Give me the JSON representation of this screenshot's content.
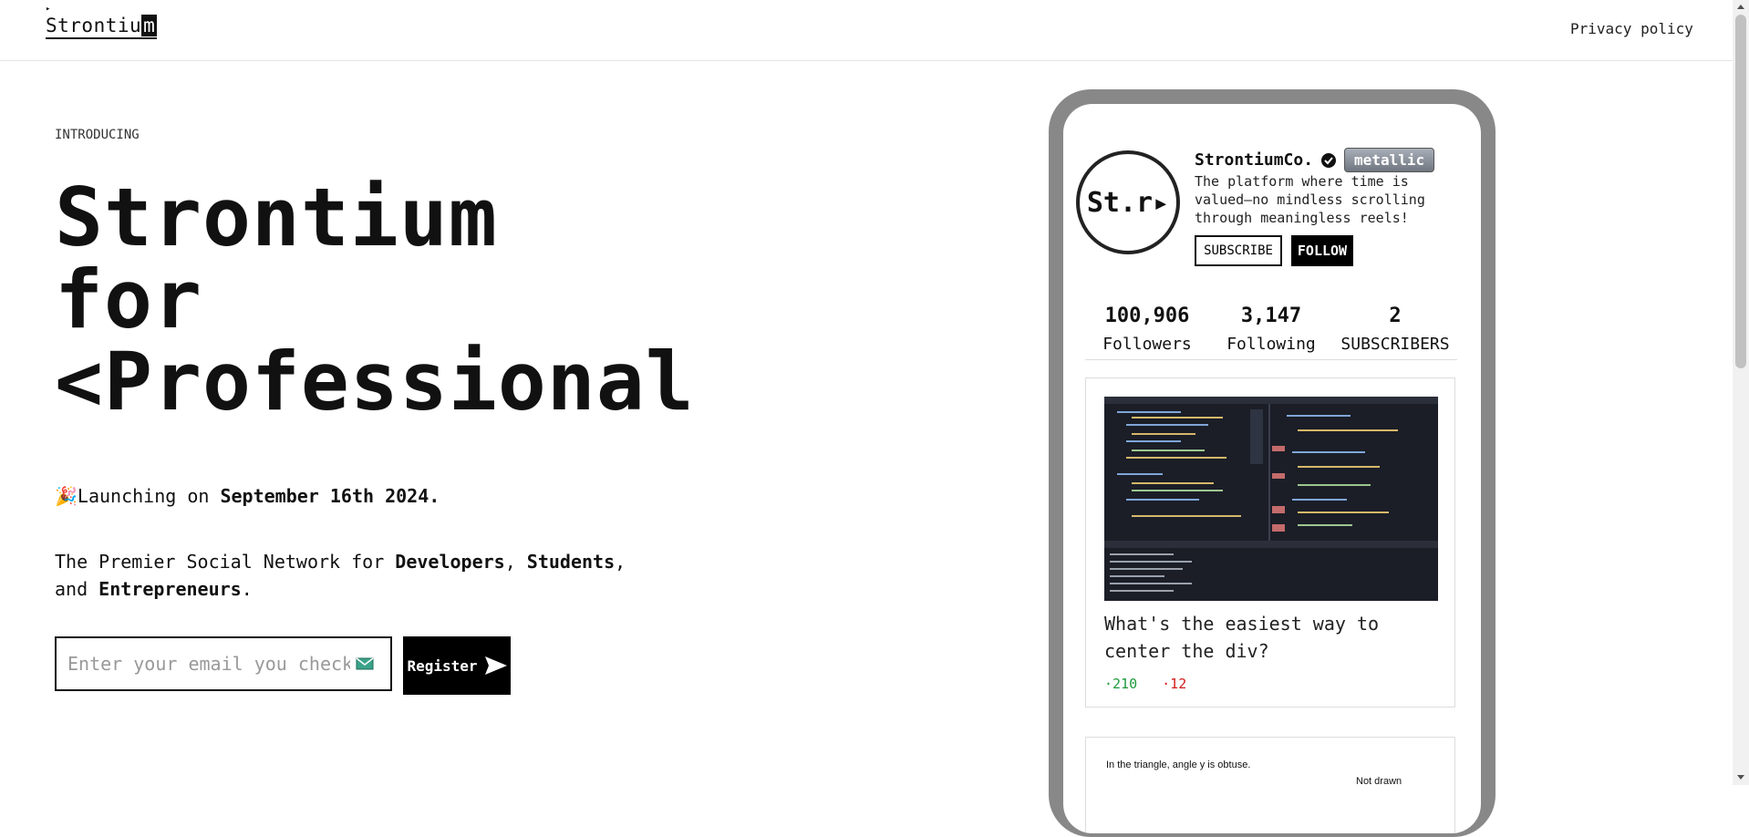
{
  "header": {
    "logo_caret": "▸",
    "logo_prefix": "Strontiu",
    "logo_highlight": "m",
    "privacy_link": "Privacy policy"
  },
  "hero": {
    "intro": "INTRODUCING",
    "headline_line1": "Strontium",
    "headline_line2": "for",
    "headline_line3": "<Professional",
    "launch_emoji": "🎉",
    "launch_prefix": "Launching on ",
    "launch_date": "September 16th 2024.",
    "tagline_prefix": "The Premier Social Network for ",
    "tagline_dev": "Developers",
    "tagline_sep1": ", ",
    "tagline_students": "Students",
    "tagline_sep2": ", and ",
    "tagline_entre": "Entrepreneurs",
    "tagline_end": "."
  },
  "signup": {
    "email_placeholder": "Enter your email you check",
    "email_icon": "mail-icon",
    "register_label": "Register",
    "register_icon": "send-icon"
  },
  "profile": {
    "avatar_text": "St.r▸",
    "name": "StrontiumCo.",
    "verified_icon": "verified-check-icon",
    "badge": "metallic",
    "bio": "The platform where time is valued—no mindless scrolling through meaningless reels!",
    "subscribe_label": "SUBSCRIBE",
    "follow_label": "FOLLOW",
    "stats": [
      {
        "value": "100,906",
        "label": "Followers"
      },
      {
        "value": "3,147",
        "label": "Following"
      },
      {
        "value": "2",
        "label": "SUBSCRIBERS"
      }
    ]
  },
  "posts": [
    {
      "image": "code-editor-screenshot",
      "title": "What's the easiest way to center the div?",
      "upvotes": "·210",
      "downvotes": "·12"
    },
    {
      "text": "In the triangle, angle y is obtuse.",
      "note": "Not drawn"
    }
  ],
  "colors": {
    "upvote": "#1c9a3a",
    "downvote": "#d21a1a",
    "phone_frame": "#888888",
    "accent": "#000000"
  }
}
